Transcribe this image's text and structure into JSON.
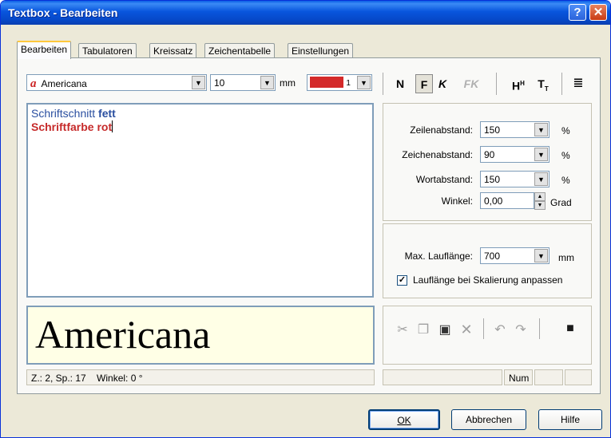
{
  "window": {
    "title": "Textbox - Bearbeiten",
    "help_glyph": "?",
    "close_glyph": "✕"
  },
  "tabs": [
    {
      "label": "Bearbeiten"
    },
    {
      "label": "Tabulatoren"
    },
    {
      "label": "Kreissatz"
    },
    {
      "label": "Zeichentabelle"
    },
    {
      "label": "Einstellungen"
    }
  ],
  "toolbar": {
    "font_name": "Americana",
    "font_size": "10",
    "size_unit": "mm",
    "color_index": "1",
    "color_swatch": "#d42a2a",
    "normal_label": "N",
    "bold_label": "F",
    "italic_label": "K",
    "bold_italic_label": "FK",
    "superscript_label": "H",
    "subscript_label": "T",
    "align_icon": "align-text-icon"
  },
  "editor": {
    "line1_prefix": "Schriftschnitt ",
    "line1_bold": "fett",
    "line2": "Schriftfarbe rot"
  },
  "spacing": {
    "line_spacing_label": "Zeilenabstand:",
    "line_spacing_value": "150",
    "char_spacing_label": "Zeichenabstand:",
    "char_spacing_value": "90",
    "word_spacing_label": "Wortabstand:",
    "word_spacing_value": "150",
    "percent_unit": "%",
    "angle_label": "Winkel:",
    "angle_value": "0,00",
    "angle_unit": "Grad"
  },
  "runlength": {
    "max_label": "Max. Lauflänge:",
    "max_value": "700",
    "unit": "mm",
    "scale_checkbox_label": "Lauflänge bei Skalierung anpassen",
    "scale_checked": true,
    "check_glyph": "✓"
  },
  "preview": {
    "text": "Americana"
  },
  "edit_icons": [
    "cut-icon",
    "copy-icon",
    "paste-icon",
    "delete-icon",
    "undo-icon",
    "redo-icon",
    "save-icon"
  ],
  "status": {
    "position": "Z.: 2, Sp.: 17",
    "angle": "Winkel: 0 °",
    "num": "Num"
  },
  "buttons": {
    "ok": "OK",
    "cancel": "Abbrechen",
    "help": "Hilfe"
  }
}
